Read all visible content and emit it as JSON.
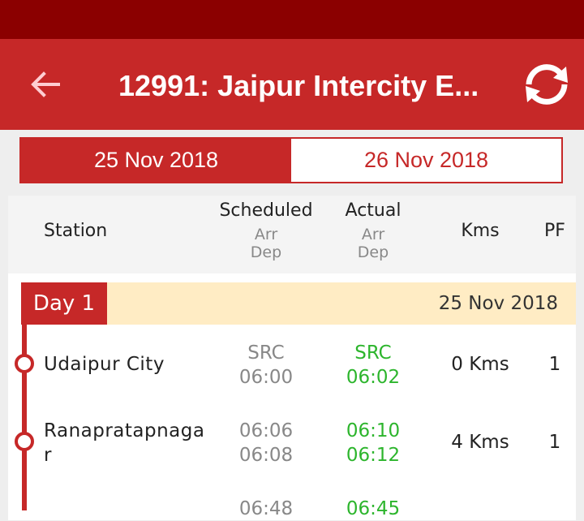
{
  "header": {
    "title": "12991: Jaipur Intercity E..."
  },
  "tabs": [
    {
      "label": "25 Nov 2018",
      "active": true
    },
    {
      "label": "26 Nov 2018",
      "active": false
    }
  ],
  "table_header": {
    "station": "Station",
    "scheduled": "Scheduled",
    "scheduled_arr": "Arr",
    "scheduled_dep": "Dep",
    "actual": "Actual",
    "actual_arr": "Arr",
    "actual_dep": "Dep",
    "kms": "Kms",
    "pf": "PF"
  },
  "day": {
    "label": "Day 1",
    "date": "25 Nov 2018"
  },
  "stops": [
    {
      "station": "Udaipur City",
      "sched_arr": "SRC",
      "sched_dep": "06:00",
      "act_arr": "SRC",
      "act_dep": "06:02",
      "kms": "0 Kms",
      "pf": "1"
    },
    {
      "station": "Ranapratapnaga r",
      "sched_arr": "06:06",
      "sched_dep": "06:08",
      "act_arr": "06:10",
      "act_dep": "06:12",
      "kms": "4 Kms",
      "pf": "1"
    },
    {
      "station": "",
      "sched_arr": "06:48",
      "sched_dep": "",
      "act_arr": "06:45",
      "act_dep": "",
      "kms": "",
      "pf": ""
    }
  ],
  "colors": {
    "primary": "#c62828",
    "status_bar": "#8b0000",
    "on_time": "#2db52d",
    "day_bg": "#ffecc4"
  }
}
